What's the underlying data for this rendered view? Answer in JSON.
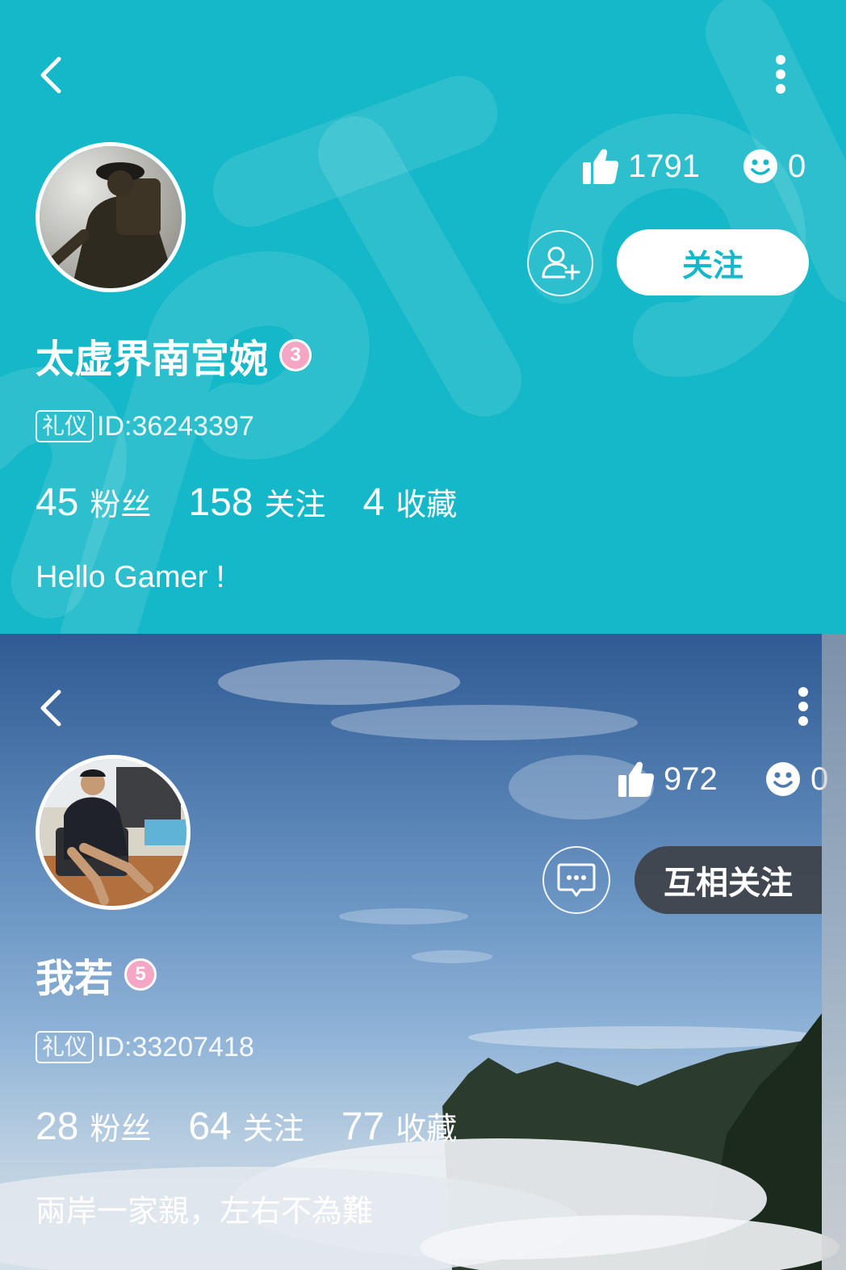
{
  "profiles": [
    {
      "likes": "1791",
      "smiles": "0",
      "action_label": "关注",
      "name": "太虚界南宫婉",
      "level": "3",
      "id_tag": "礼仪",
      "id_text": "ID:36243397",
      "fans_count": "45",
      "fans_label": "粉丝",
      "following_count": "158",
      "following_label": "关注",
      "fav_count": "4",
      "fav_label": "收藏",
      "bio": "Hello Gamer !"
    },
    {
      "likes": "972",
      "smiles": "0",
      "action_label": "互相关注",
      "name": "我若",
      "level": "5",
      "id_tag": "礼仪",
      "id_text": "ID:33207418",
      "fans_count": "28",
      "fans_label": "粉丝",
      "following_count": "64",
      "following_label": "关注",
      "fav_count": "77",
      "fav_label": "收藏",
      "bio": "兩岸一家親，左右不為難"
    }
  ],
  "colors": {
    "top_bg": "#14b8c8",
    "follow_text": "#14b8c8",
    "level_badge": "#f4a6c4",
    "mutual_bg": "#3c3e42"
  },
  "icons": [
    "back-arrow-icon",
    "more-vertical-icon",
    "thumbs-up-icon",
    "smiley-icon",
    "add-user-icon",
    "message-icon"
  ]
}
